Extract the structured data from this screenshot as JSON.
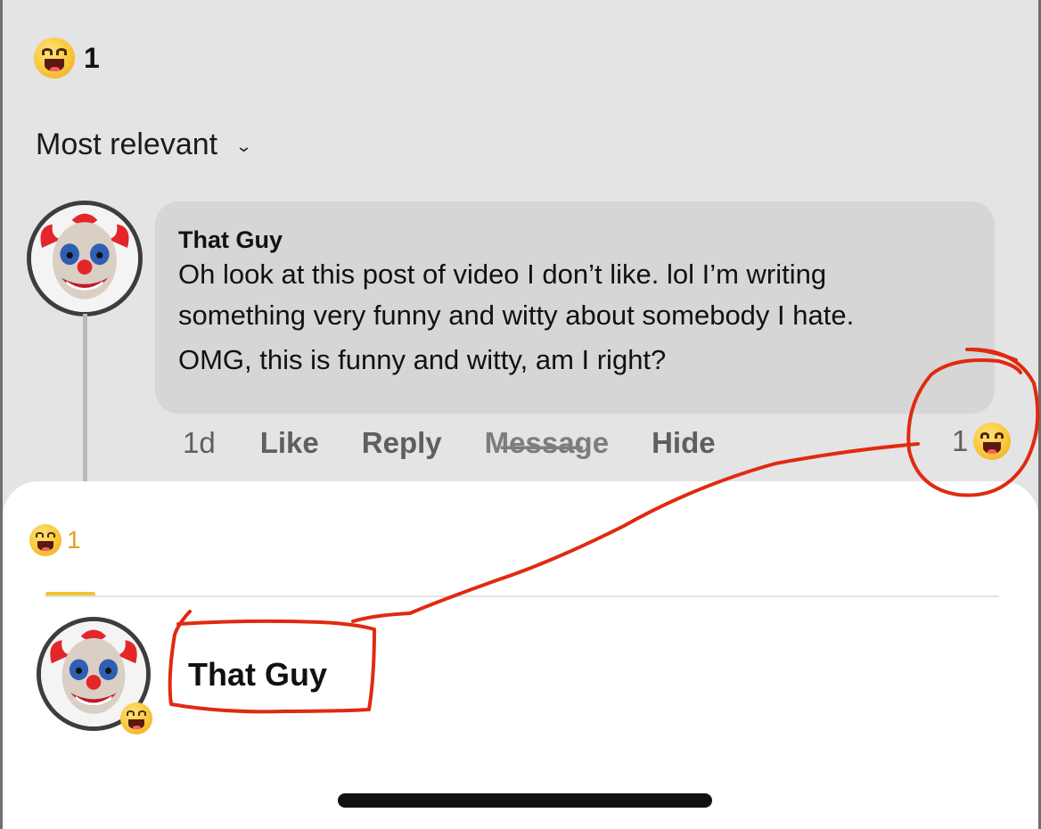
{
  "top_reaction": {
    "icon": "laughing-emoji-icon",
    "count": "1"
  },
  "sort": {
    "label": "Most relevant",
    "chevron": "⌄"
  },
  "comment": {
    "author": "That Guy",
    "lines": [
      "Oh look at this post of video I don’t like. lol  I’m writing",
      "something very funny and witty about somebody I hate.",
      "OMG, this is funny and witty, am I right?"
    ],
    "time": "1d",
    "actions": {
      "like": "Like",
      "reply": "Reply",
      "message": "M̶e̶s̶s̶a̶ge",
      "hide": "Hide"
    },
    "reaction_count": "1"
  },
  "sheet": {
    "tab_count": "1",
    "reactor_name": "That Guy"
  },
  "colors": {
    "annotation_red": "#e02a10",
    "tab_accent": "#f2c232",
    "bubble_bg": "#d6d6d6",
    "page_bg": "#e4e4e4"
  }
}
